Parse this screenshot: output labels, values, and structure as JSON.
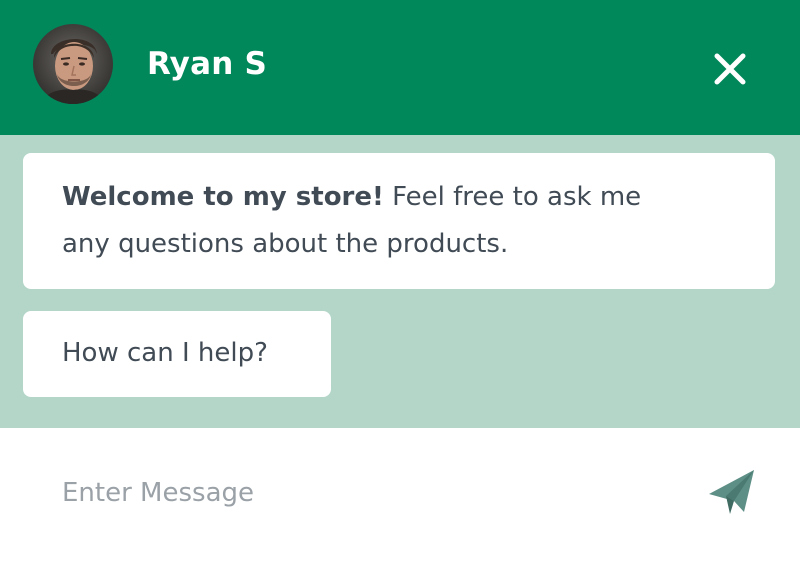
{
  "header": {
    "agent_name": "Ryan S",
    "avatar_icon": "user-avatar-photo",
    "close_icon": "close-icon",
    "background_color": "#00875a"
  },
  "messages": {
    "background_color": "#b4d6c9",
    "items": [
      {
        "bold_text": "Welcome to my store!",
        "text_line_1": "Feel free to ask me",
        "text_line_2": "any questions about the products."
      },
      {
        "text": "How can I help?"
      }
    ]
  },
  "composer": {
    "placeholder": "Enter Message",
    "value": "",
    "send_icon": "send-paper-plane-icon",
    "send_icon_color": "#5e8f86"
  }
}
